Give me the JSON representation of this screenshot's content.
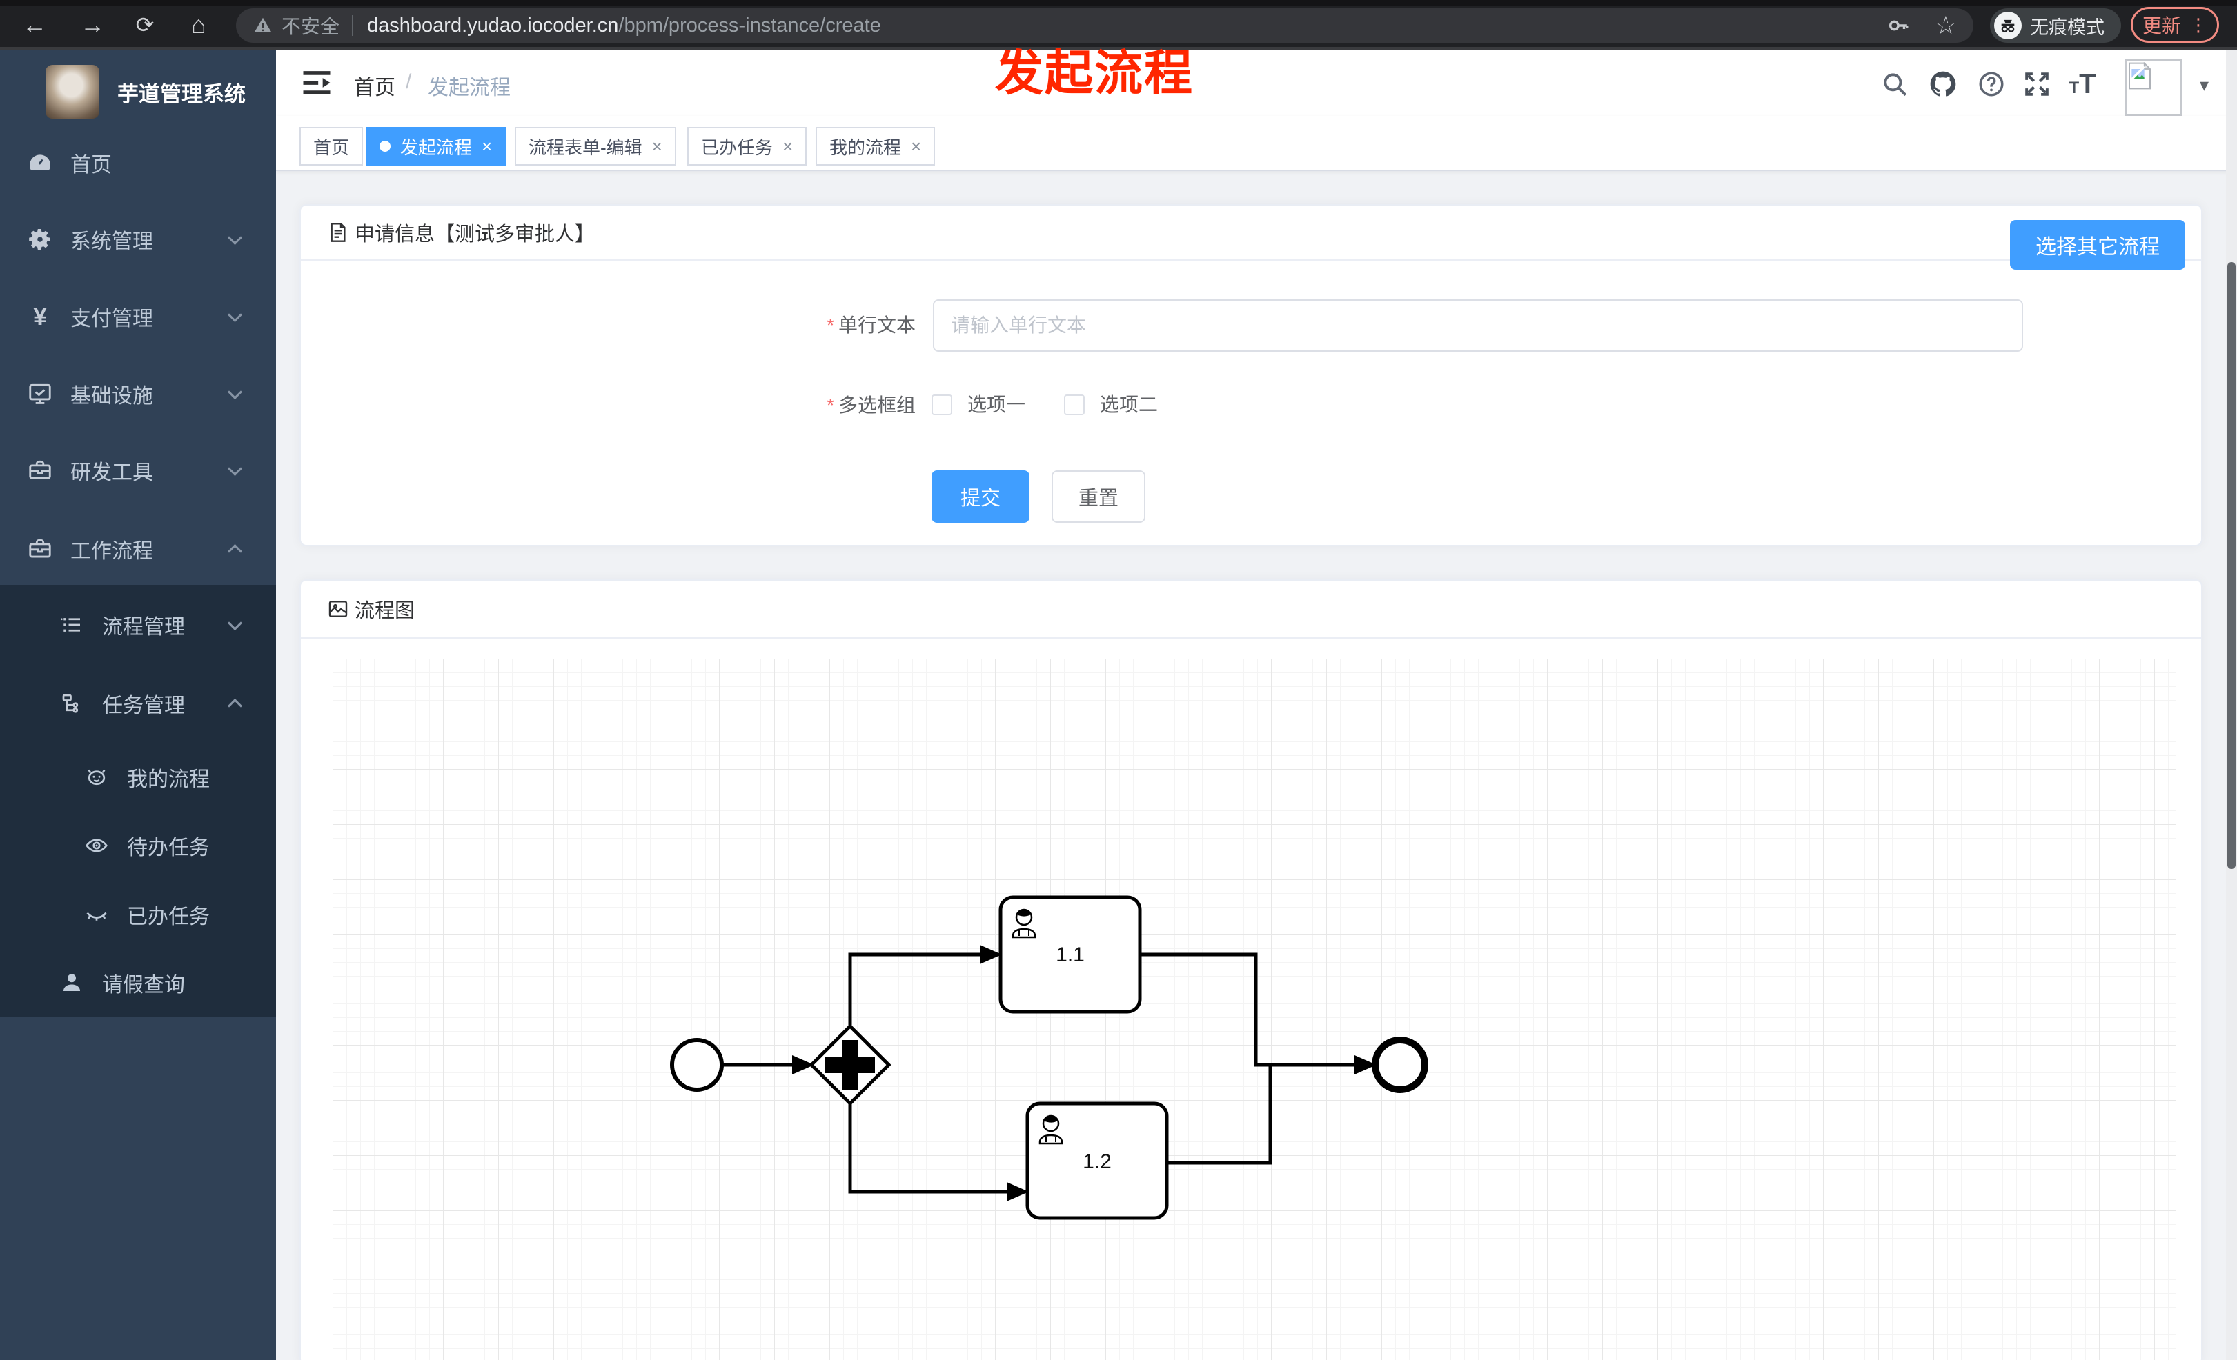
{
  "browser": {
    "security_label": "不安全",
    "url_host": "dashboard.yudao.iocoder.cn",
    "url_path": "/bpm/process-instance/create",
    "incognito_label": "无痕模式",
    "update_label": "更新"
  },
  "annotation": {
    "text": "发起流程",
    "color": "#ff2600"
  },
  "sidebar": {
    "title": "芋道管理系统",
    "items": [
      {
        "label": "首页"
      },
      {
        "label": "系统管理"
      },
      {
        "label": "支付管理"
      },
      {
        "label": "基础设施"
      },
      {
        "label": "研发工具"
      },
      {
        "label": "工作流程"
      },
      {
        "label": "流程管理"
      },
      {
        "label": "任务管理"
      },
      {
        "label": "我的流程"
      },
      {
        "label": "待办任务"
      },
      {
        "label": "已办任务"
      },
      {
        "label": "请假查询"
      }
    ],
    "yen_glyph": "¥"
  },
  "header": {
    "breadcrumb": [
      "首页",
      "发起流程"
    ],
    "separator": "/"
  },
  "tabs": [
    {
      "label": "首页"
    },
    {
      "label": "发起流程"
    },
    {
      "label": "流程表单-编辑"
    },
    {
      "label": "已办任务"
    },
    {
      "label": "我的流程"
    }
  ],
  "form_card": {
    "title": "申请信息【测试多审批人】",
    "select_other_button": "选择其它流程",
    "text_field": {
      "label": "单行文本",
      "placeholder": "请输入单行文本",
      "required_mark": "*"
    },
    "checkbox_group": {
      "label": "多选框组",
      "required_mark": "*",
      "option1": "选项一",
      "option2": "选项二"
    },
    "submit_label": "提交",
    "reset_label": "重置"
  },
  "diagram_card": {
    "title": "流程图",
    "task1_label": "1.1",
    "task2_label": "1.2"
  },
  "colors": {
    "accent": "#409eff",
    "sidebar_bg": "#304156",
    "submenu_bg": "#1f2d3d",
    "annotation_red": "#ff2600",
    "update_salmon": "#f28b82"
  }
}
